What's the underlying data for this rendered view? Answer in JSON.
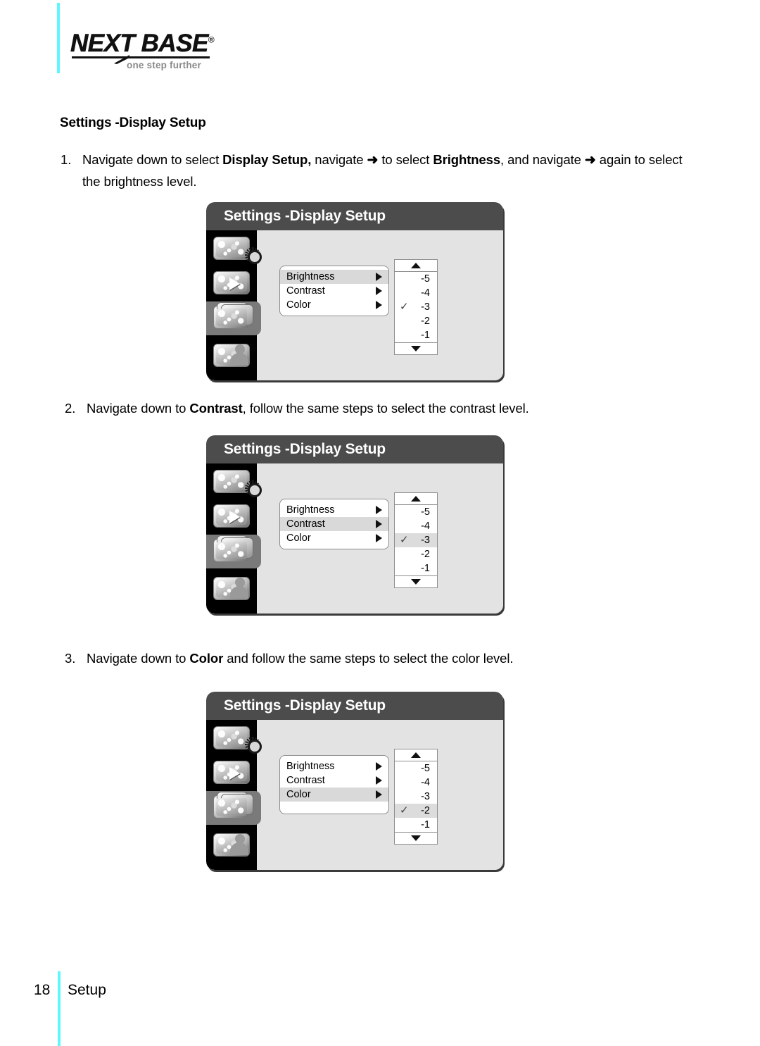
{
  "brand": {
    "wordmark": "NEXT BASE",
    "registered": "®",
    "tagline": "one step further"
  },
  "page": {
    "heading": "Settings -Display Setup",
    "footer_page_number": "18",
    "footer_section": "Setup"
  },
  "accent_colors": {
    "rule": "#5ef6ff",
    "titlebar": "#4c4c4c",
    "screen_body": "#e3e3e3",
    "row_highlight": "#d9d9d9",
    "rail_highlight": "#7a7a7a"
  },
  "steps": [
    {
      "number": "1.",
      "text_parts": [
        {
          "t": "Navigate down to select ",
          "b": false
        },
        {
          "t": "Display Setup,",
          "b": true
        },
        {
          "t": " navigate ",
          "b": false
        },
        {
          "t": "➜",
          "b": false,
          "arrow": true
        },
        {
          "t": " to select ",
          "b": false
        },
        {
          "t": "Brightness",
          "b": true
        },
        {
          "t": ", and navigate ",
          "b": false
        },
        {
          "t": "➜",
          "b": false,
          "arrow": true
        },
        {
          "t": " again to select the brightness level.",
          "b": false
        }
      ],
      "plain": "Navigate down to select Display Setup, navigate ➜ to select Brightness, and navigate ➜ again to select the brightness level."
    },
    {
      "number": "2.",
      "text_parts": [
        {
          "t": "Navigate down to ",
          "b": false
        },
        {
          "t": "Contrast",
          "b": true
        },
        {
          "t": ", follow the same steps to select the contrast level.",
          "b": false
        }
      ],
      "plain": "Navigate down to Contrast, follow the same steps to select the contrast level."
    },
    {
      "number": "3.",
      "text_parts": [
        {
          "t": "Navigate down to ",
          "b": false
        },
        {
          "t": "Color",
          "b": true
        },
        {
          "t": " and follow the same steps to select the color level.",
          "b": false
        }
      ],
      "plain": "Navigate down to Color and follow the same steps to select the color level."
    }
  ],
  "device_screens": [
    {
      "title": "Settings -Display Setup",
      "sidebar_icons": [
        {
          "name": "camera-settings-icon",
          "selected": false
        },
        {
          "name": "playback-icon",
          "selected": false
        },
        {
          "name": "setup-stack-icon",
          "selected": true
        },
        {
          "name": "profile-icon",
          "selected": false
        }
      ],
      "menu_items": [
        {
          "label": "Brightness",
          "selected": true
        },
        {
          "label": "Contrast",
          "selected": false
        },
        {
          "label": "Color",
          "selected": false
        }
      ],
      "menu_has_spacer": false,
      "value_list": {
        "up_arrow": "▲",
        "down_arrow": "▼",
        "values": [
          "-5",
          "-4",
          "-3",
          "-2",
          "-1"
        ],
        "checked_value": "-3",
        "checked_highlighted": false,
        "check_glyph": "✓"
      }
    },
    {
      "title": "Settings -Display Setup",
      "sidebar_icons": [
        {
          "name": "camera-settings-icon",
          "selected": false
        },
        {
          "name": "playback-icon",
          "selected": false
        },
        {
          "name": "setup-stack-icon",
          "selected": true
        },
        {
          "name": "profile-icon",
          "selected": false
        }
      ],
      "menu_items": [
        {
          "label": "Brightness",
          "selected": false
        },
        {
          "label": "Contrast",
          "selected": true
        },
        {
          "label": "Color",
          "selected": false
        }
      ],
      "menu_has_spacer": false,
      "value_list": {
        "up_arrow": "▲",
        "down_arrow": "▼",
        "values": [
          "-5",
          "-4",
          "-3",
          "-2",
          "-1"
        ],
        "checked_value": "-3",
        "checked_highlighted": true,
        "check_glyph": "✓"
      }
    },
    {
      "title": "Settings -Display Setup",
      "sidebar_icons": [
        {
          "name": "camera-settings-icon",
          "selected": false
        },
        {
          "name": "playback-icon",
          "selected": false
        },
        {
          "name": "setup-stack-icon",
          "selected": true
        },
        {
          "name": "profile-icon",
          "selected": false
        }
      ],
      "menu_items": [
        {
          "label": "Brightness",
          "selected": false
        },
        {
          "label": "Contrast",
          "selected": false
        },
        {
          "label": "Color",
          "selected": true
        }
      ],
      "menu_has_spacer": true,
      "value_list": {
        "up_arrow": "▲",
        "down_arrow": "▼",
        "values": [
          "-5",
          "-4",
          "-3",
          "-2",
          "-1"
        ],
        "checked_value": "-2",
        "checked_highlighted": true,
        "check_glyph": "✓"
      }
    }
  ]
}
